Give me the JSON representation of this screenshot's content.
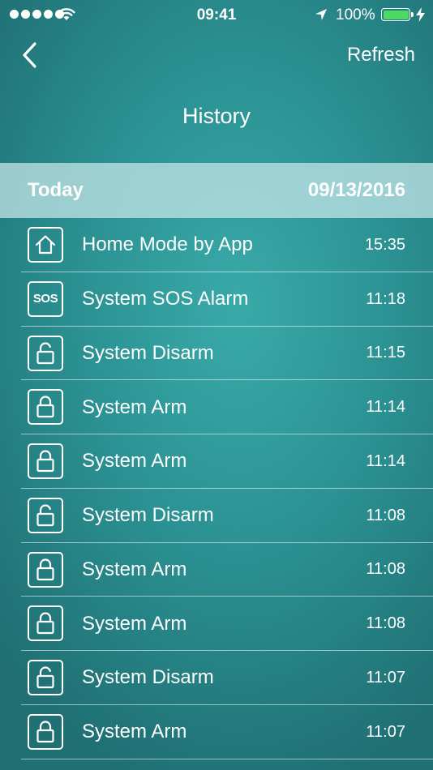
{
  "status_bar": {
    "time": "09:41",
    "battery_percent": "100%",
    "signal_bars": 5,
    "battery_level": 1.0,
    "icons": {
      "signal": "signal-dots-icon",
      "wifi": "wifi-icon",
      "location": "location-arrow-icon",
      "battery": "battery-icon",
      "charging": "lightning-bolt-icon"
    },
    "battery_color": "#4cd964"
  },
  "nav": {
    "back_icon": "chevron-left-icon",
    "refresh_label": "Refresh",
    "title": "History"
  },
  "section": {
    "label": "Today",
    "date": "09/13/2016"
  },
  "items": [
    {
      "icon": "home",
      "label": "Home Mode by App",
      "time": "15:35"
    },
    {
      "icon": "sos",
      "label": "System SOS Alarm",
      "time": "11:18"
    },
    {
      "icon": "unlock",
      "label": "System Disarm",
      "time": "11:15"
    },
    {
      "icon": "lock",
      "label": "System Arm",
      "time": "11:14"
    },
    {
      "icon": "lock",
      "label": "System Arm",
      "time": "11:14"
    },
    {
      "icon": "unlock",
      "label": "System Disarm",
      "time": "11:08"
    },
    {
      "icon": "lock",
      "label": "System Arm",
      "time": "11:08"
    },
    {
      "icon": "lock",
      "label": "System Arm",
      "time": "11:08"
    },
    {
      "icon": "unlock",
      "label": "System Disarm",
      "time": "11:07"
    },
    {
      "icon": "lock",
      "label": "System Arm",
      "time": "11:07"
    }
  ],
  "sos_icon_text": "SOS",
  "colors": {
    "background_center": "#39aaa9",
    "background_edge": "#1f6f73",
    "section_header": "#bee2e4",
    "text": "#ffffff"
  }
}
